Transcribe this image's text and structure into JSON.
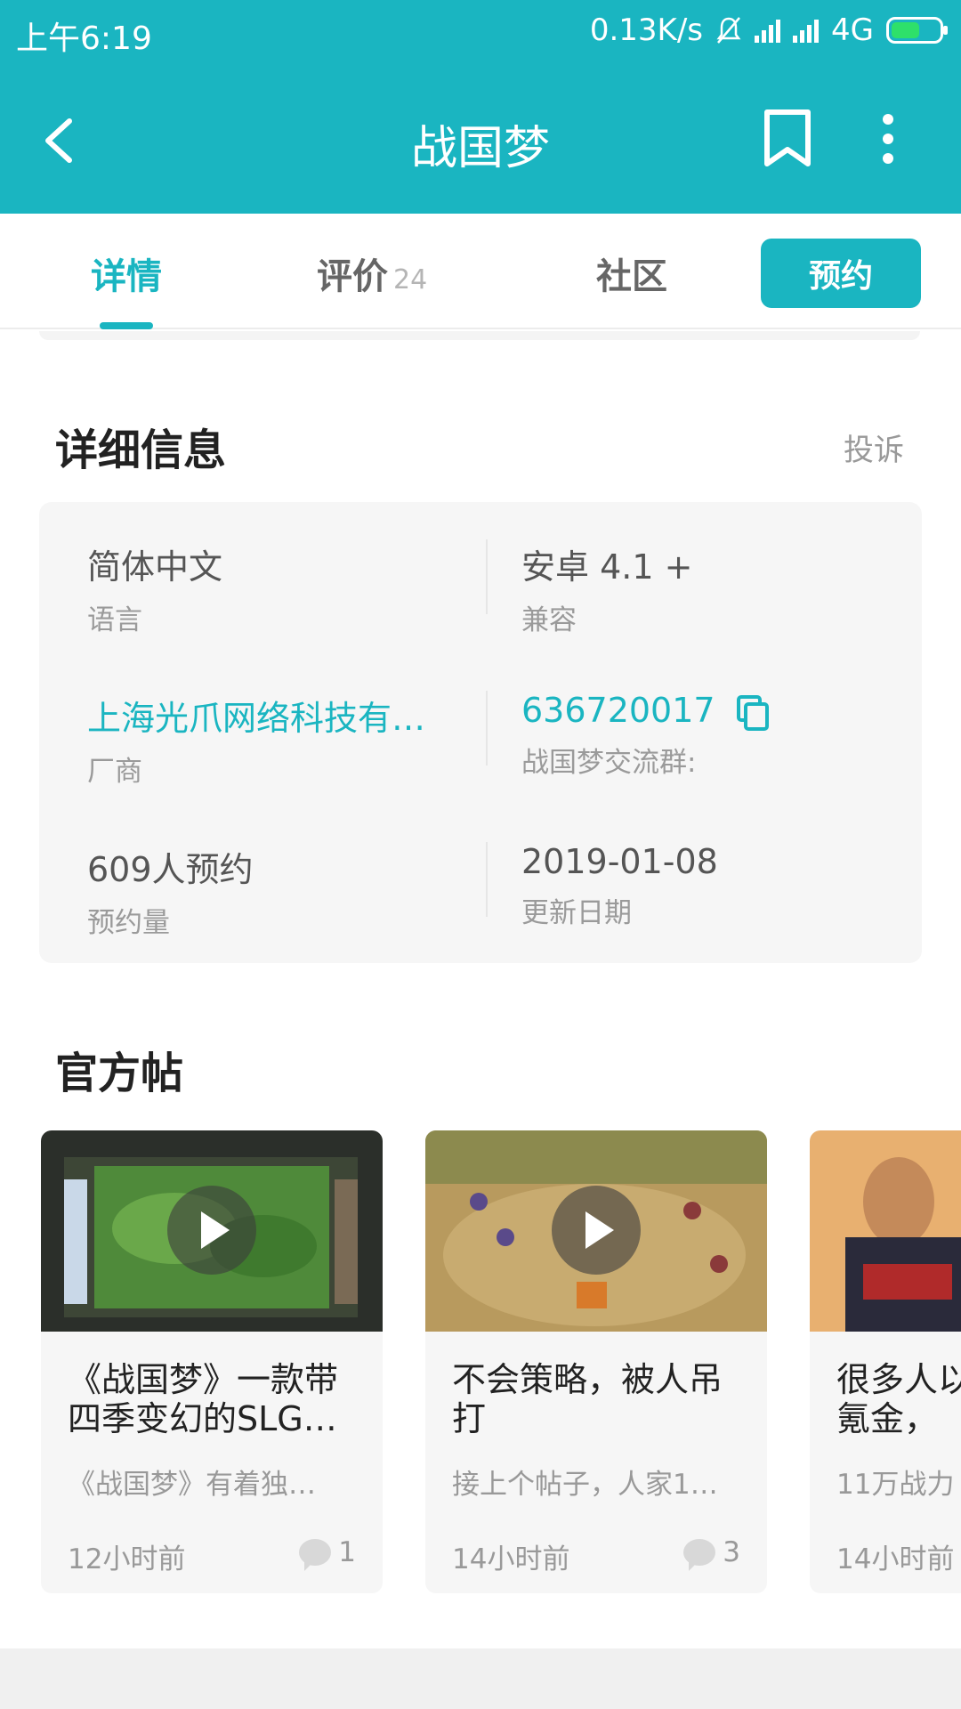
{
  "status_bar": {
    "time": "上午6:19",
    "network_speed": "0.13K/s",
    "network_type": "4G",
    "battery_level": 0.6,
    "icons": [
      "mute-bell-icon",
      "signal-icon",
      "signal-icon",
      "battery-charging-icon"
    ]
  },
  "header": {
    "title": "战国梦",
    "icons": [
      "back-arrow-icon",
      "bookmark-icon",
      "more-vertical-icon"
    ]
  },
  "tabs": {
    "details": "详情",
    "reviews": "评价",
    "reviews_count": "24",
    "community": "社区",
    "reserve_button": "预约"
  },
  "details": {
    "heading": "详细信息",
    "report_link": "投诉",
    "language_value": "简体中文",
    "language_label": "语言",
    "compat_value": "安卓 4.1 +",
    "compat_label": "兼容",
    "vendor_value": "上海光爪网络科技有限公司",
    "vendor_label": "厂商",
    "group_value": "636720017",
    "group_label": "战国梦交流群:",
    "reservations_value": "609人预约",
    "reservations_label": "预约量",
    "updated_value": "2019-01-08",
    "updated_label": "更新日期"
  },
  "official_posts": {
    "heading": "官方帖",
    "items": [
      {
        "title": "《战国梦》一款带四季变幻的SLG…",
        "desc": "《战国梦》有着独…",
        "time": "12小时前",
        "comments": "1"
      },
      {
        "title": "不会策略，被人吊打",
        "desc": "接上个帖子，人家1…",
        "time": "14小时前",
        "comments": "3"
      },
      {
        "title": "很多人以为这游戏氪金，",
        "desc": "11万战力",
        "time": "14小时前",
        "comments": ""
      }
    ]
  },
  "colors": {
    "accent": "#1ab5c1",
    "card_bg": "#f6f6f6"
  }
}
